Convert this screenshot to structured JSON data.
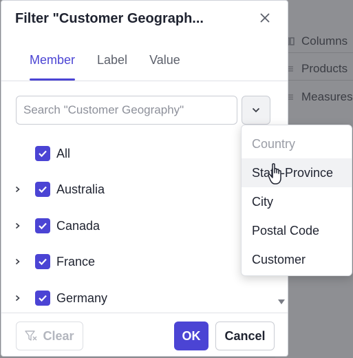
{
  "background": {
    "items": [
      {
        "icon": "columns-icon",
        "label": "Columns"
      },
      {
        "icon": "drag-handle-icon",
        "label": "Products"
      },
      {
        "icon": "drag-handle-icon",
        "label": "Measures"
      }
    ]
  },
  "dialog": {
    "title": "Filter \"Customer Geograph...",
    "tabs": [
      {
        "label": "Member",
        "active": true
      },
      {
        "label": "Label",
        "active": false
      },
      {
        "label": "Value",
        "active": false
      }
    ],
    "search": {
      "placeholder": "Search \"Customer Geography\"",
      "value": ""
    },
    "members": [
      {
        "label": "All",
        "checked": true,
        "expandable": false
      },
      {
        "label": "Australia",
        "checked": true,
        "expandable": true
      },
      {
        "label": "Canada",
        "checked": true,
        "expandable": true
      },
      {
        "label": "France",
        "checked": true,
        "expandable": true
      },
      {
        "label": "Germany",
        "checked": true,
        "expandable": true
      }
    ],
    "buttons": {
      "clear": "Clear",
      "ok": "OK",
      "cancel": "Cancel"
    }
  },
  "level_menu": {
    "items": [
      {
        "label": "Country",
        "disabled": true
      },
      {
        "label": "State-Province",
        "hover": true
      },
      {
        "label": "City"
      },
      {
        "label": "Postal Code"
      },
      {
        "label": "Customer"
      }
    ]
  },
  "colors": {
    "accent": "#4b44d4",
    "text": "#1f2330",
    "muted": "#8d909a"
  }
}
